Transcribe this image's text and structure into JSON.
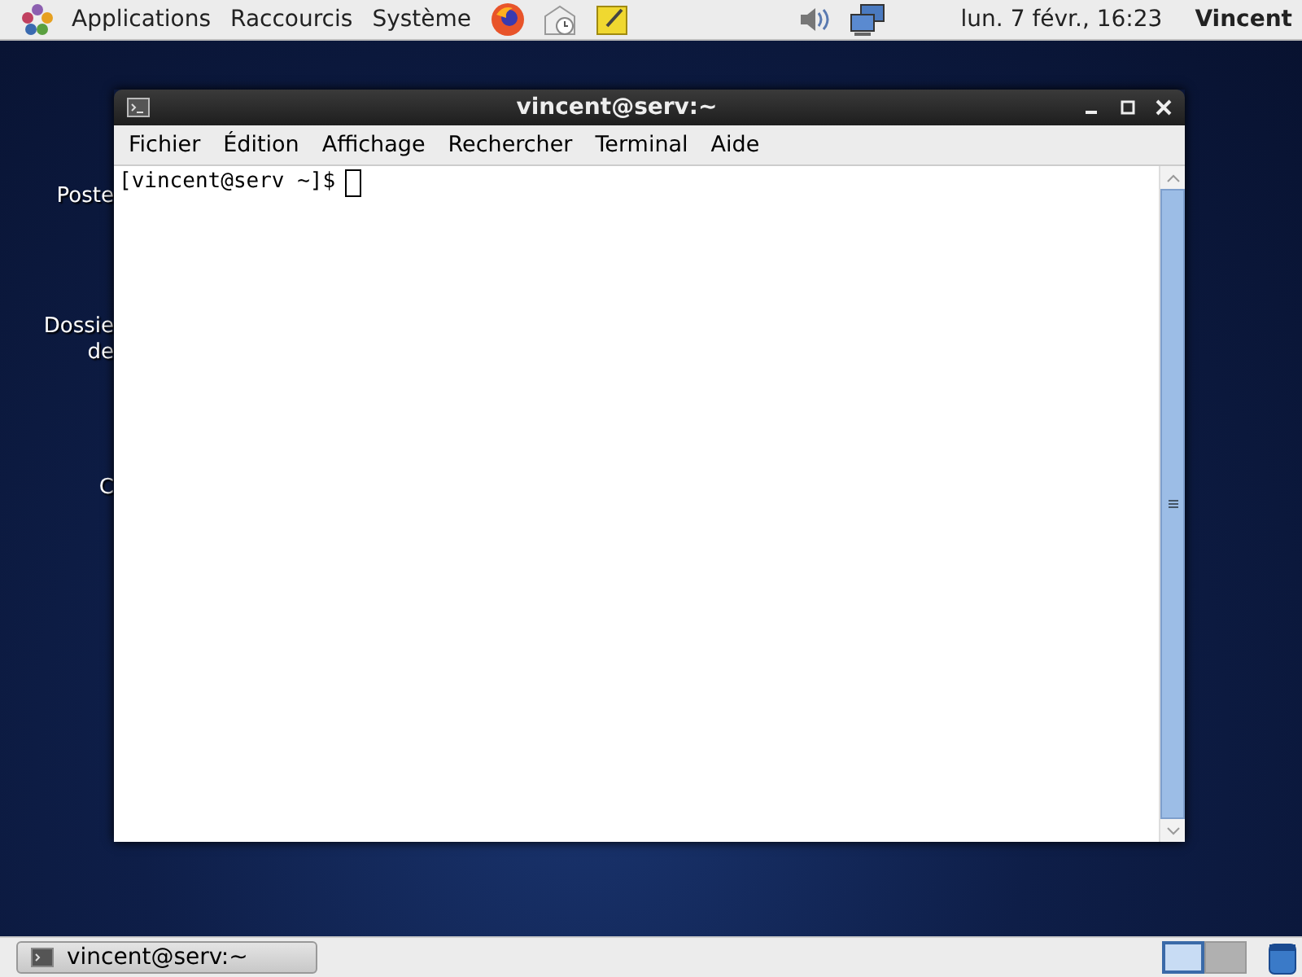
{
  "top_panel": {
    "menus": [
      "Applications",
      "Raccourcis",
      "Système"
    ],
    "clock": "lun.  7 févr., 16:23",
    "user": "Vincent"
  },
  "desktop_icons": [
    {
      "lines": [
        "Poste"
      ]
    },
    {
      "lines": [
        "Dossie",
        "de"
      ]
    },
    {
      "lines": [
        "C"
      ]
    }
  ],
  "window": {
    "title": "vincent@serv:~",
    "menu": [
      "Fichier",
      "Édition",
      "Affichage",
      "Rechercher",
      "Terminal",
      "Aide"
    ],
    "prompt": "[vincent@serv ~]$"
  },
  "bottom_panel": {
    "task": "vincent@serv:~",
    "workspaces": [
      {
        "selected": true
      },
      {
        "selected": false
      }
    ]
  }
}
